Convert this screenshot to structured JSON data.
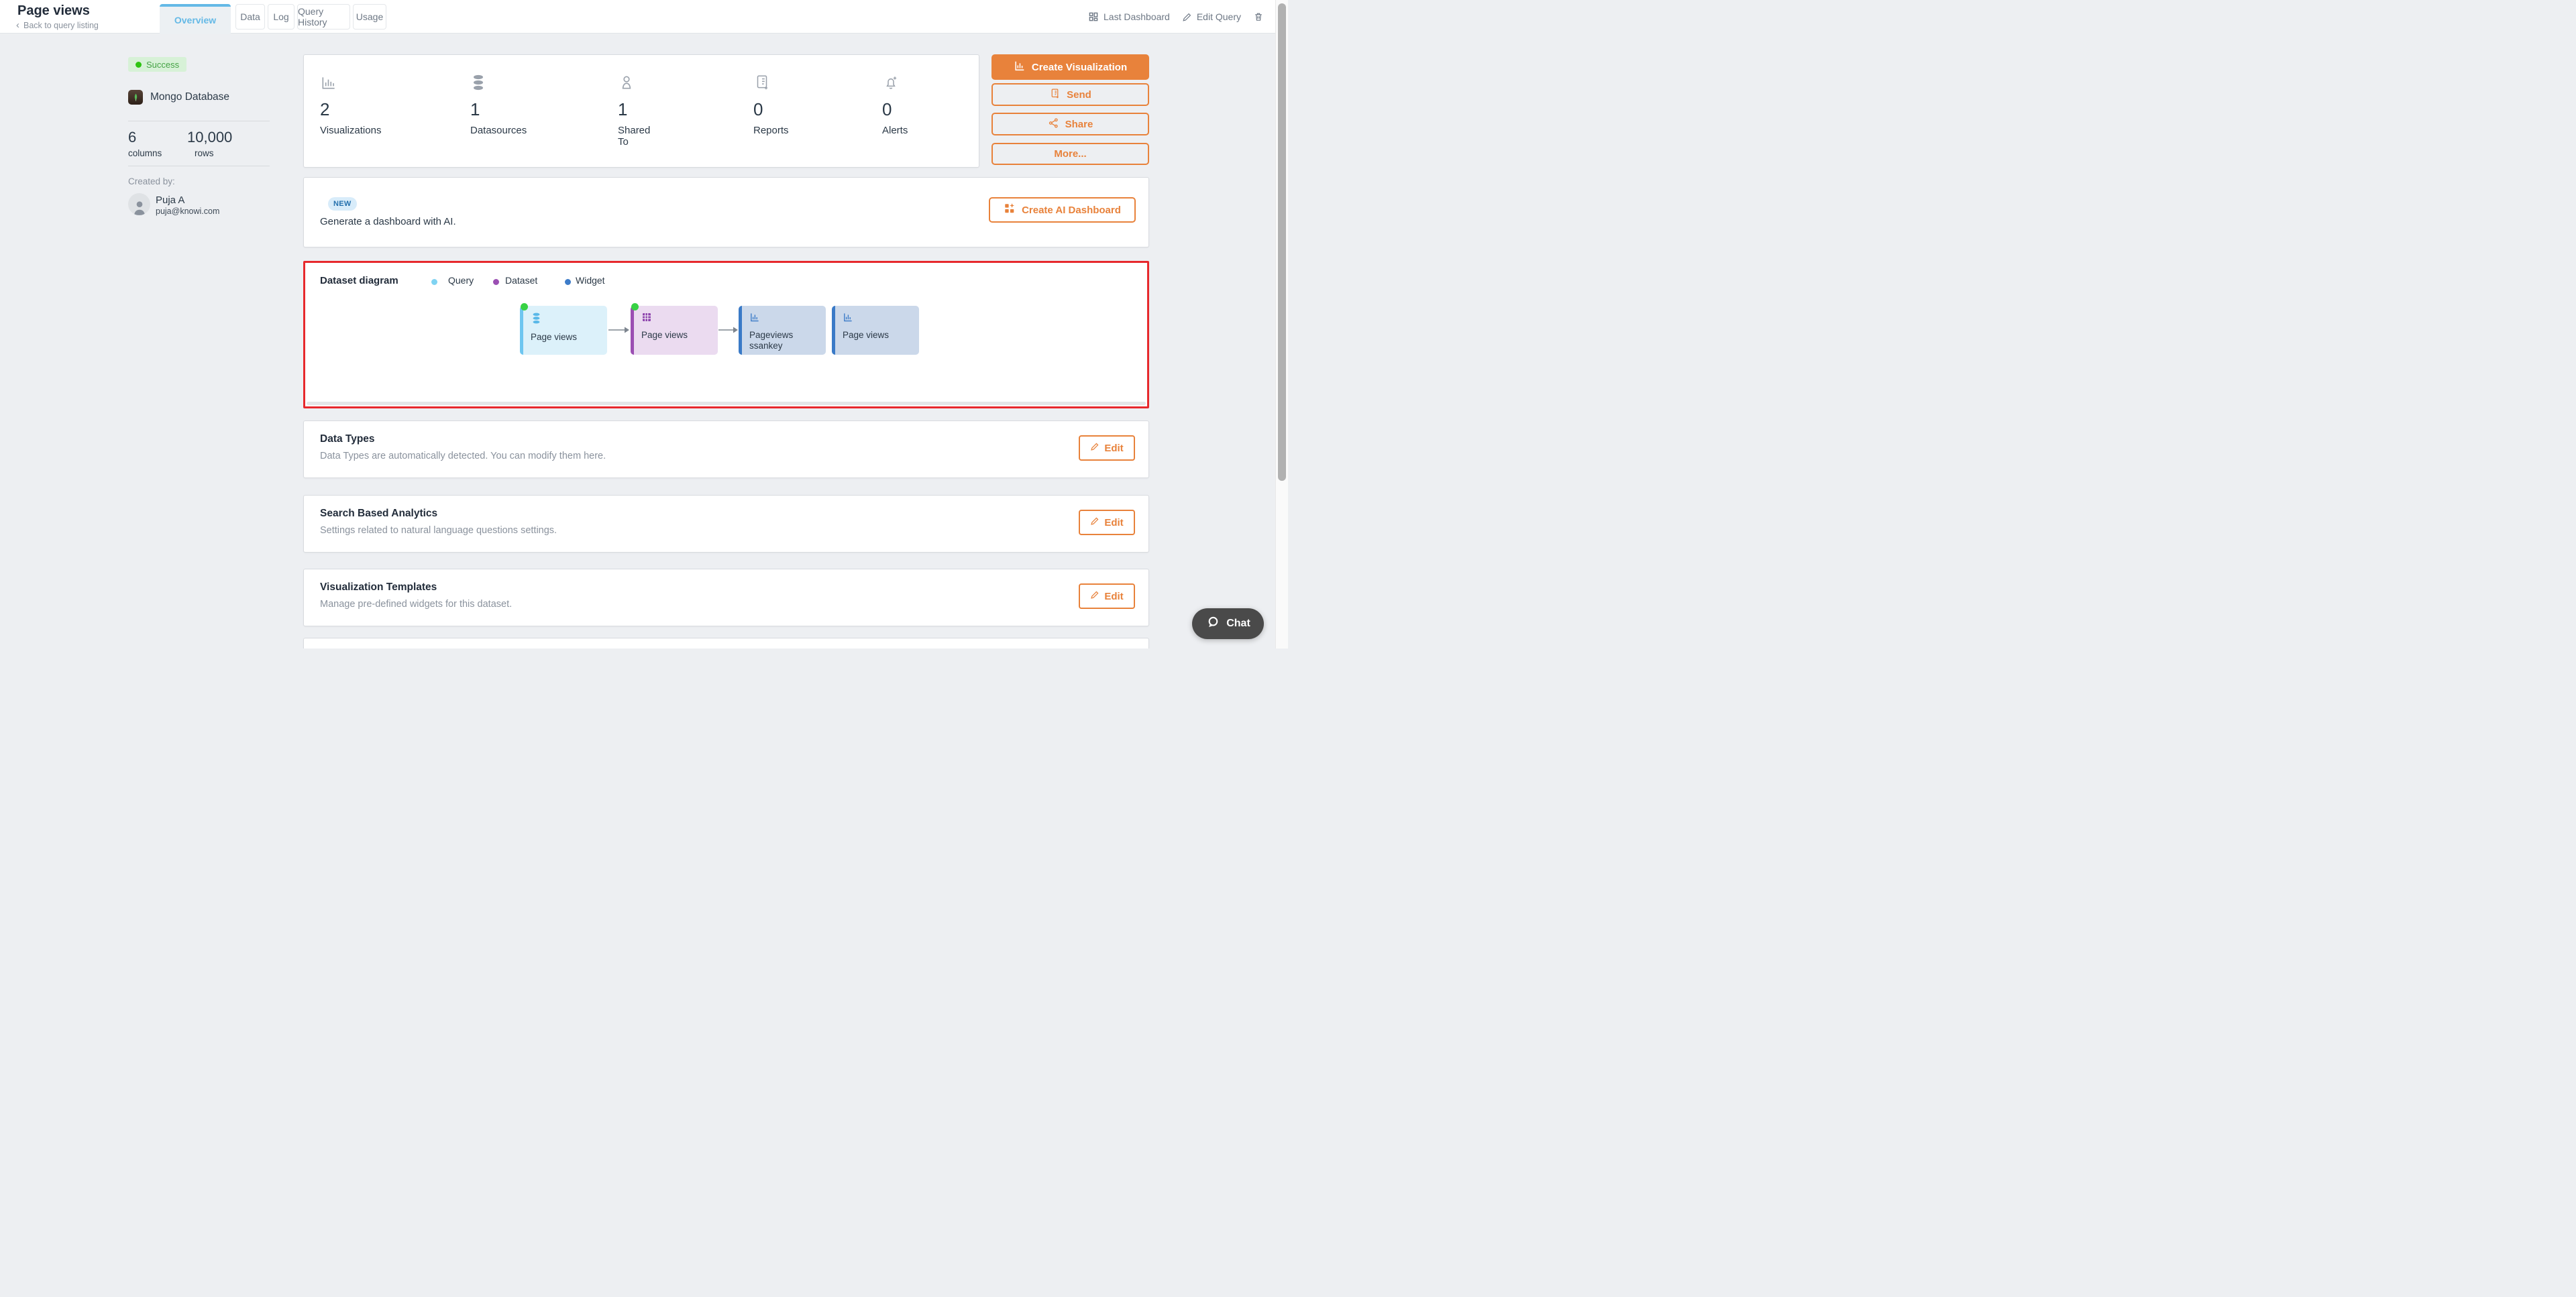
{
  "colors": {
    "accent_orange": "#E8823B",
    "active_tab_blue": "#64B9E6",
    "annotation_red": "#E7292D",
    "page_background": "#EDEFF2",
    "success_green": "#2EC412",
    "legend_query": "#7FD3F2",
    "legend_dataset": "#9B4FB3",
    "legend_widget": "#3D7CC9"
  },
  "header": {
    "title": "Page views",
    "back": {
      "chevron": "‹",
      "label": "Back to query listing"
    },
    "tabs": [
      {
        "label": "Overview",
        "active": true
      },
      {
        "label": "Data",
        "active": false
      },
      {
        "label": "Log",
        "active": false
      },
      {
        "label": "Query History",
        "active": false
      },
      {
        "label": "Usage",
        "active": false
      }
    ],
    "actions": {
      "last_dashboard": "Last Dashboard",
      "edit_query": "Edit Query"
    }
  },
  "sidebar": {
    "status_badge": "Success",
    "datasource": "Mongo Database",
    "columns": {
      "value": "6",
      "label": "columns"
    },
    "rows": {
      "value": "10,000",
      "label": "rows"
    },
    "created_by_label": "Created by:",
    "creator": {
      "name": "Puja A",
      "email": "puja@knowi.com"
    }
  },
  "stats": {
    "items": [
      {
        "value": "2",
        "label": "Visualizations",
        "icon": "bar-chart-icon"
      },
      {
        "value": "1",
        "label": "Datasources",
        "icon": "database-icon"
      },
      {
        "value": "1",
        "label": "Shared To",
        "icon": "person-icon"
      },
      {
        "value": "0",
        "label": "Reports",
        "icon": "report-icon"
      },
      {
        "value": "0",
        "label": "Alerts",
        "icon": "bell-icon"
      }
    ]
  },
  "actions_panel": {
    "create_visualization": "Create Visualization",
    "send": "Send",
    "share": "Share",
    "more": "More..."
  },
  "ai_banner": {
    "badge": "NEW",
    "text": "Generate a dashboard with AI.",
    "button": "Create AI Dashboard"
  },
  "dataset_diagram": {
    "title": "Dataset diagram",
    "legend": [
      {
        "label": "Query",
        "color": "#7FD3F2"
      },
      {
        "label": "Dataset",
        "color": "#9B4FB3"
      },
      {
        "label": "Widget",
        "color": "#3D7CC9"
      }
    ],
    "nodes": [
      {
        "label": "Page views",
        "type": "query",
        "icon": "database-icon",
        "status_dot": true
      },
      {
        "label": "Page views",
        "type": "dataset",
        "icon": "table-icon",
        "status_dot": true
      },
      {
        "label": "Pageviews ssankey",
        "type": "widget",
        "icon": "bar-chart-icon",
        "status_dot": false
      },
      {
        "label": "Page views",
        "type": "widget",
        "icon": "bar-chart-icon",
        "status_dot": false
      }
    ]
  },
  "sections": [
    {
      "title": "Data Types",
      "description": "Data Types are automatically detected. You can modify them here.",
      "button": "Edit"
    },
    {
      "title": "Search Based Analytics",
      "description": "Settings related to natural language questions settings.",
      "button": "Edit"
    },
    {
      "title": "Visualization Templates",
      "description": "Manage pre-defined widgets for this dataset.",
      "button": "Edit"
    }
  ],
  "chat": {
    "label": "Chat"
  }
}
